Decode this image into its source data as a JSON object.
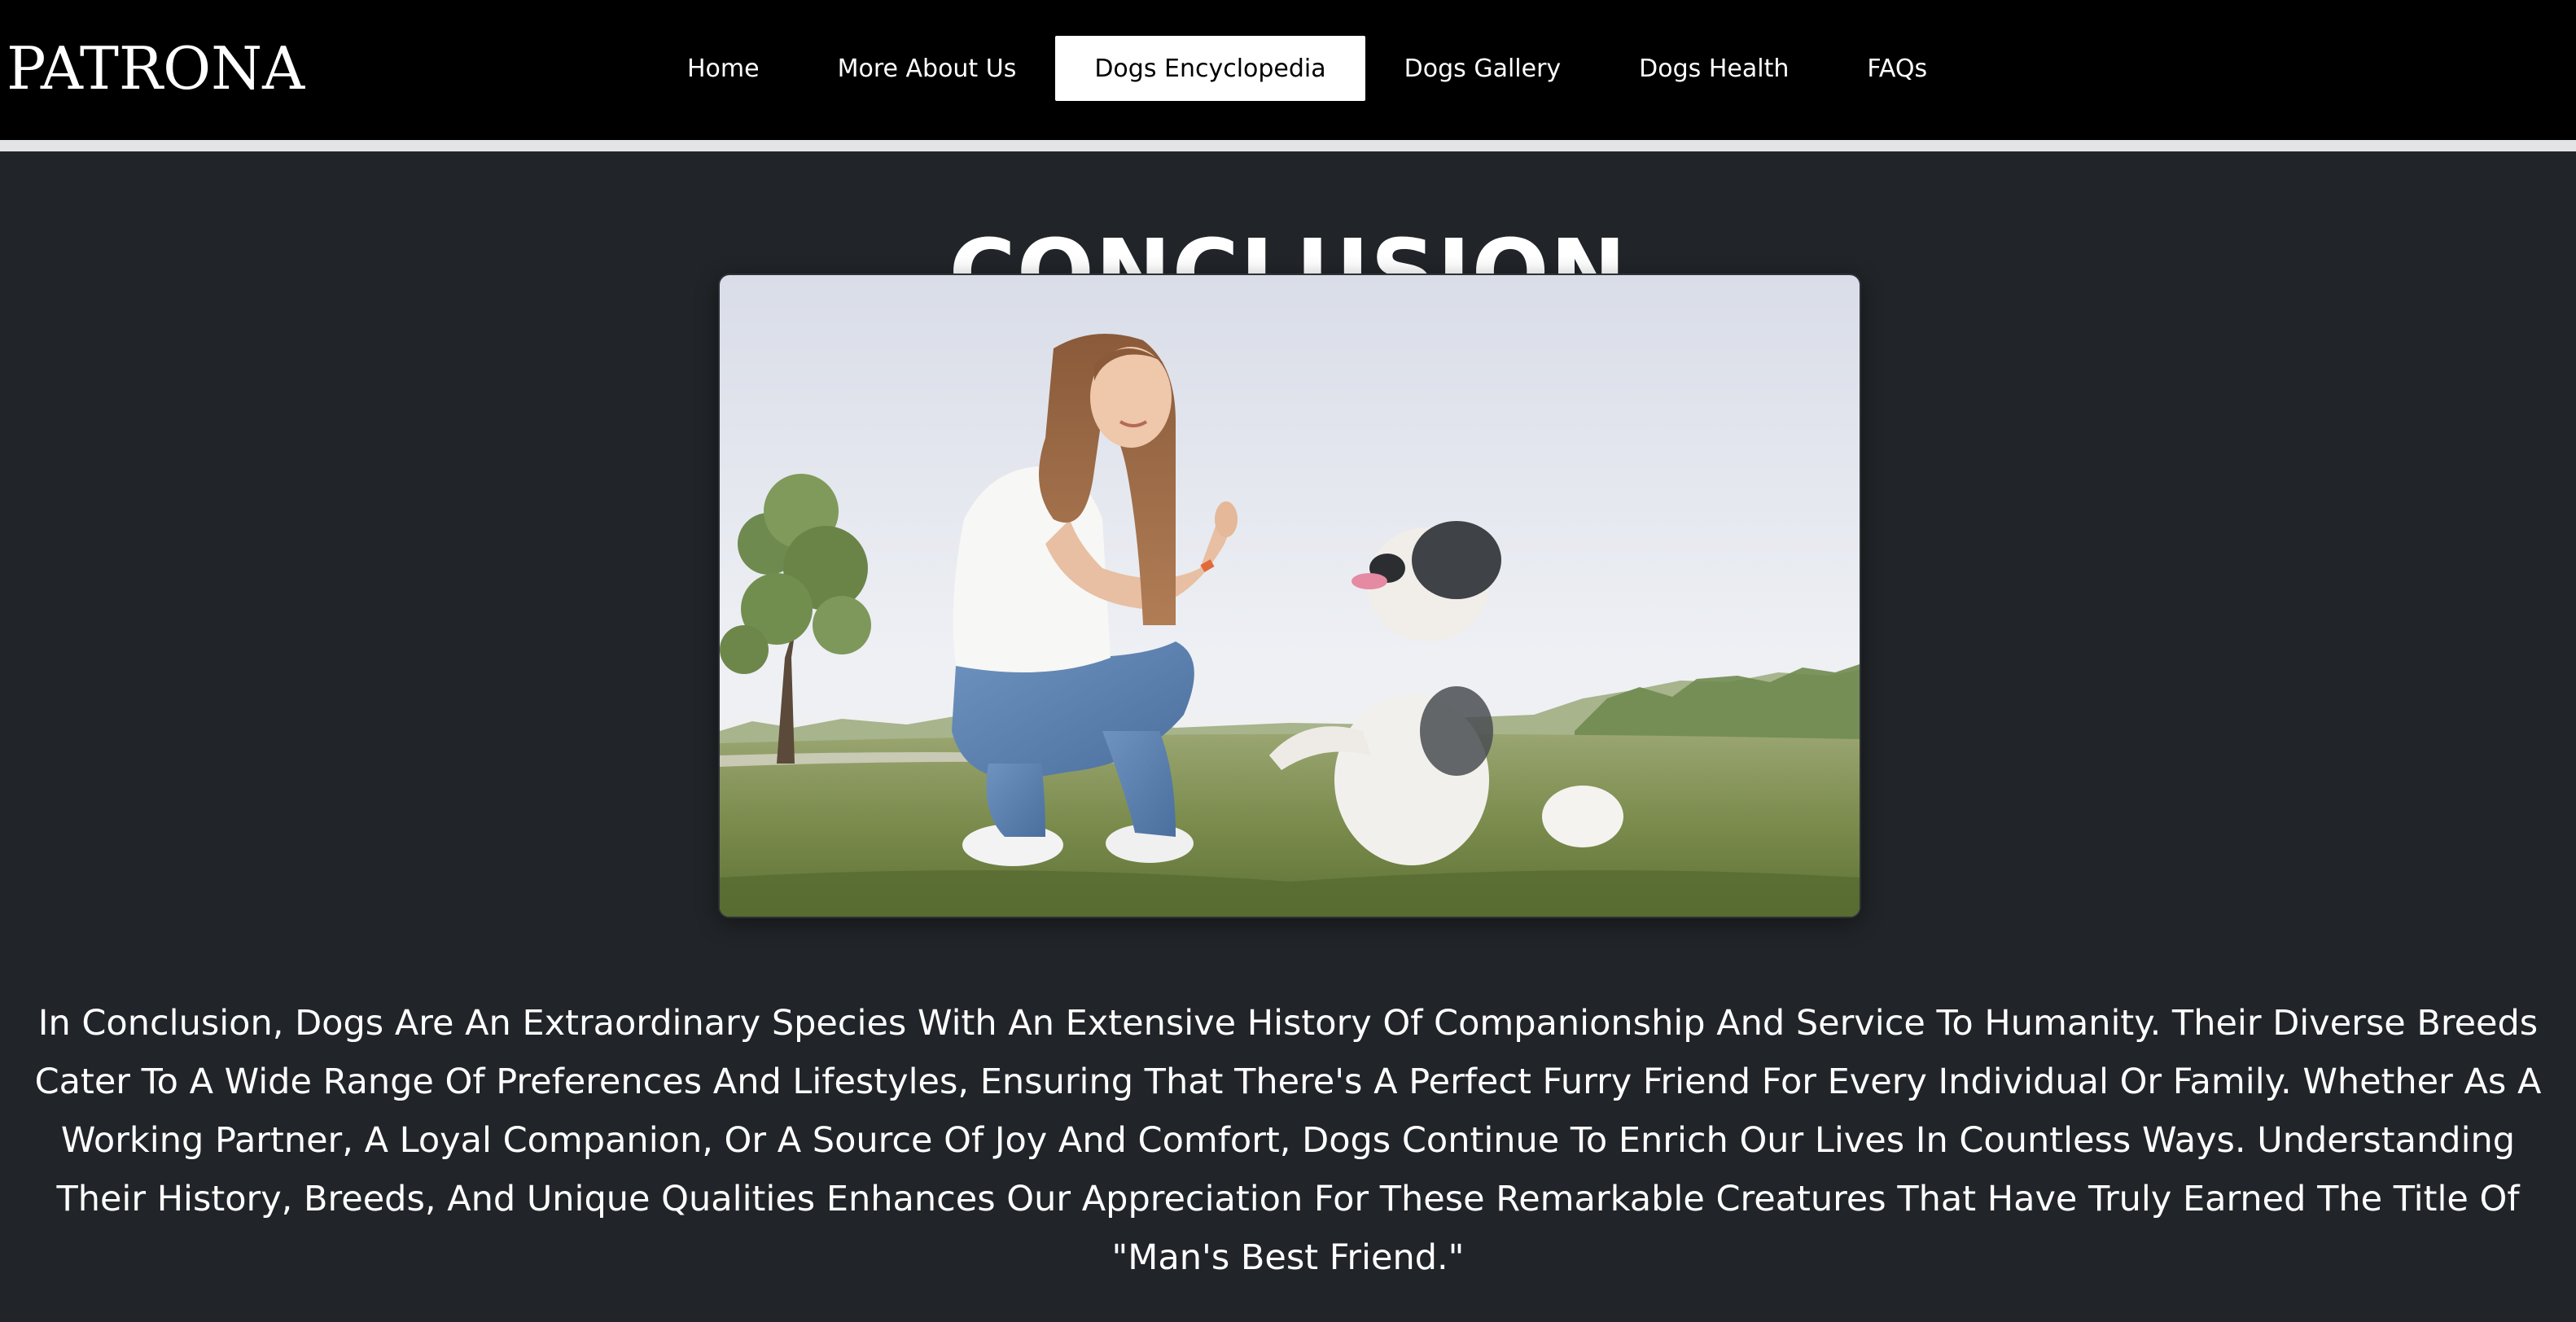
{
  "header": {
    "brand": "PATRONA",
    "nav": [
      {
        "label": "Home",
        "active": false
      },
      {
        "label": "More About Us",
        "active": false
      },
      {
        "label": "Dogs Encyclopedia",
        "active": true
      },
      {
        "label": "Dogs Gallery",
        "active": false
      },
      {
        "label": "Dogs Health",
        "active": false
      },
      {
        "label": "FAQs",
        "active": false
      }
    ]
  },
  "main": {
    "title": "CONCLUSION",
    "image": {
      "description_icon": "photo-woman-with-dog"
    },
    "paragraph": "In Conclusion, Dogs Are An Extraordinary Species With An Extensive History Of Companionship And Service To Humanity. Their Diverse Breeds Cater To A Wide Range Of Preferences And Lifestyles, Ensuring That There's A Perfect Furry Friend For Every Individual Or Family. Whether As A Working Partner, A Loyal Companion, Or A Source Of Joy And Comfort, Dogs Continue To Enrich Our Lives In Countless Ways. Understanding Their History, Breeds, And Unique Qualities Enhances Our Appreciation For These Remarkable Creatures That Have Truly Earned The Title Of \"Man's Best Friend.\""
  },
  "colors": {
    "header_bg": "#000000",
    "page_bg": "#212428",
    "divider": "#e3e4e6",
    "text": "#ffffff",
    "active_nav_bg": "#ffffff",
    "active_nav_text": "#000000"
  }
}
